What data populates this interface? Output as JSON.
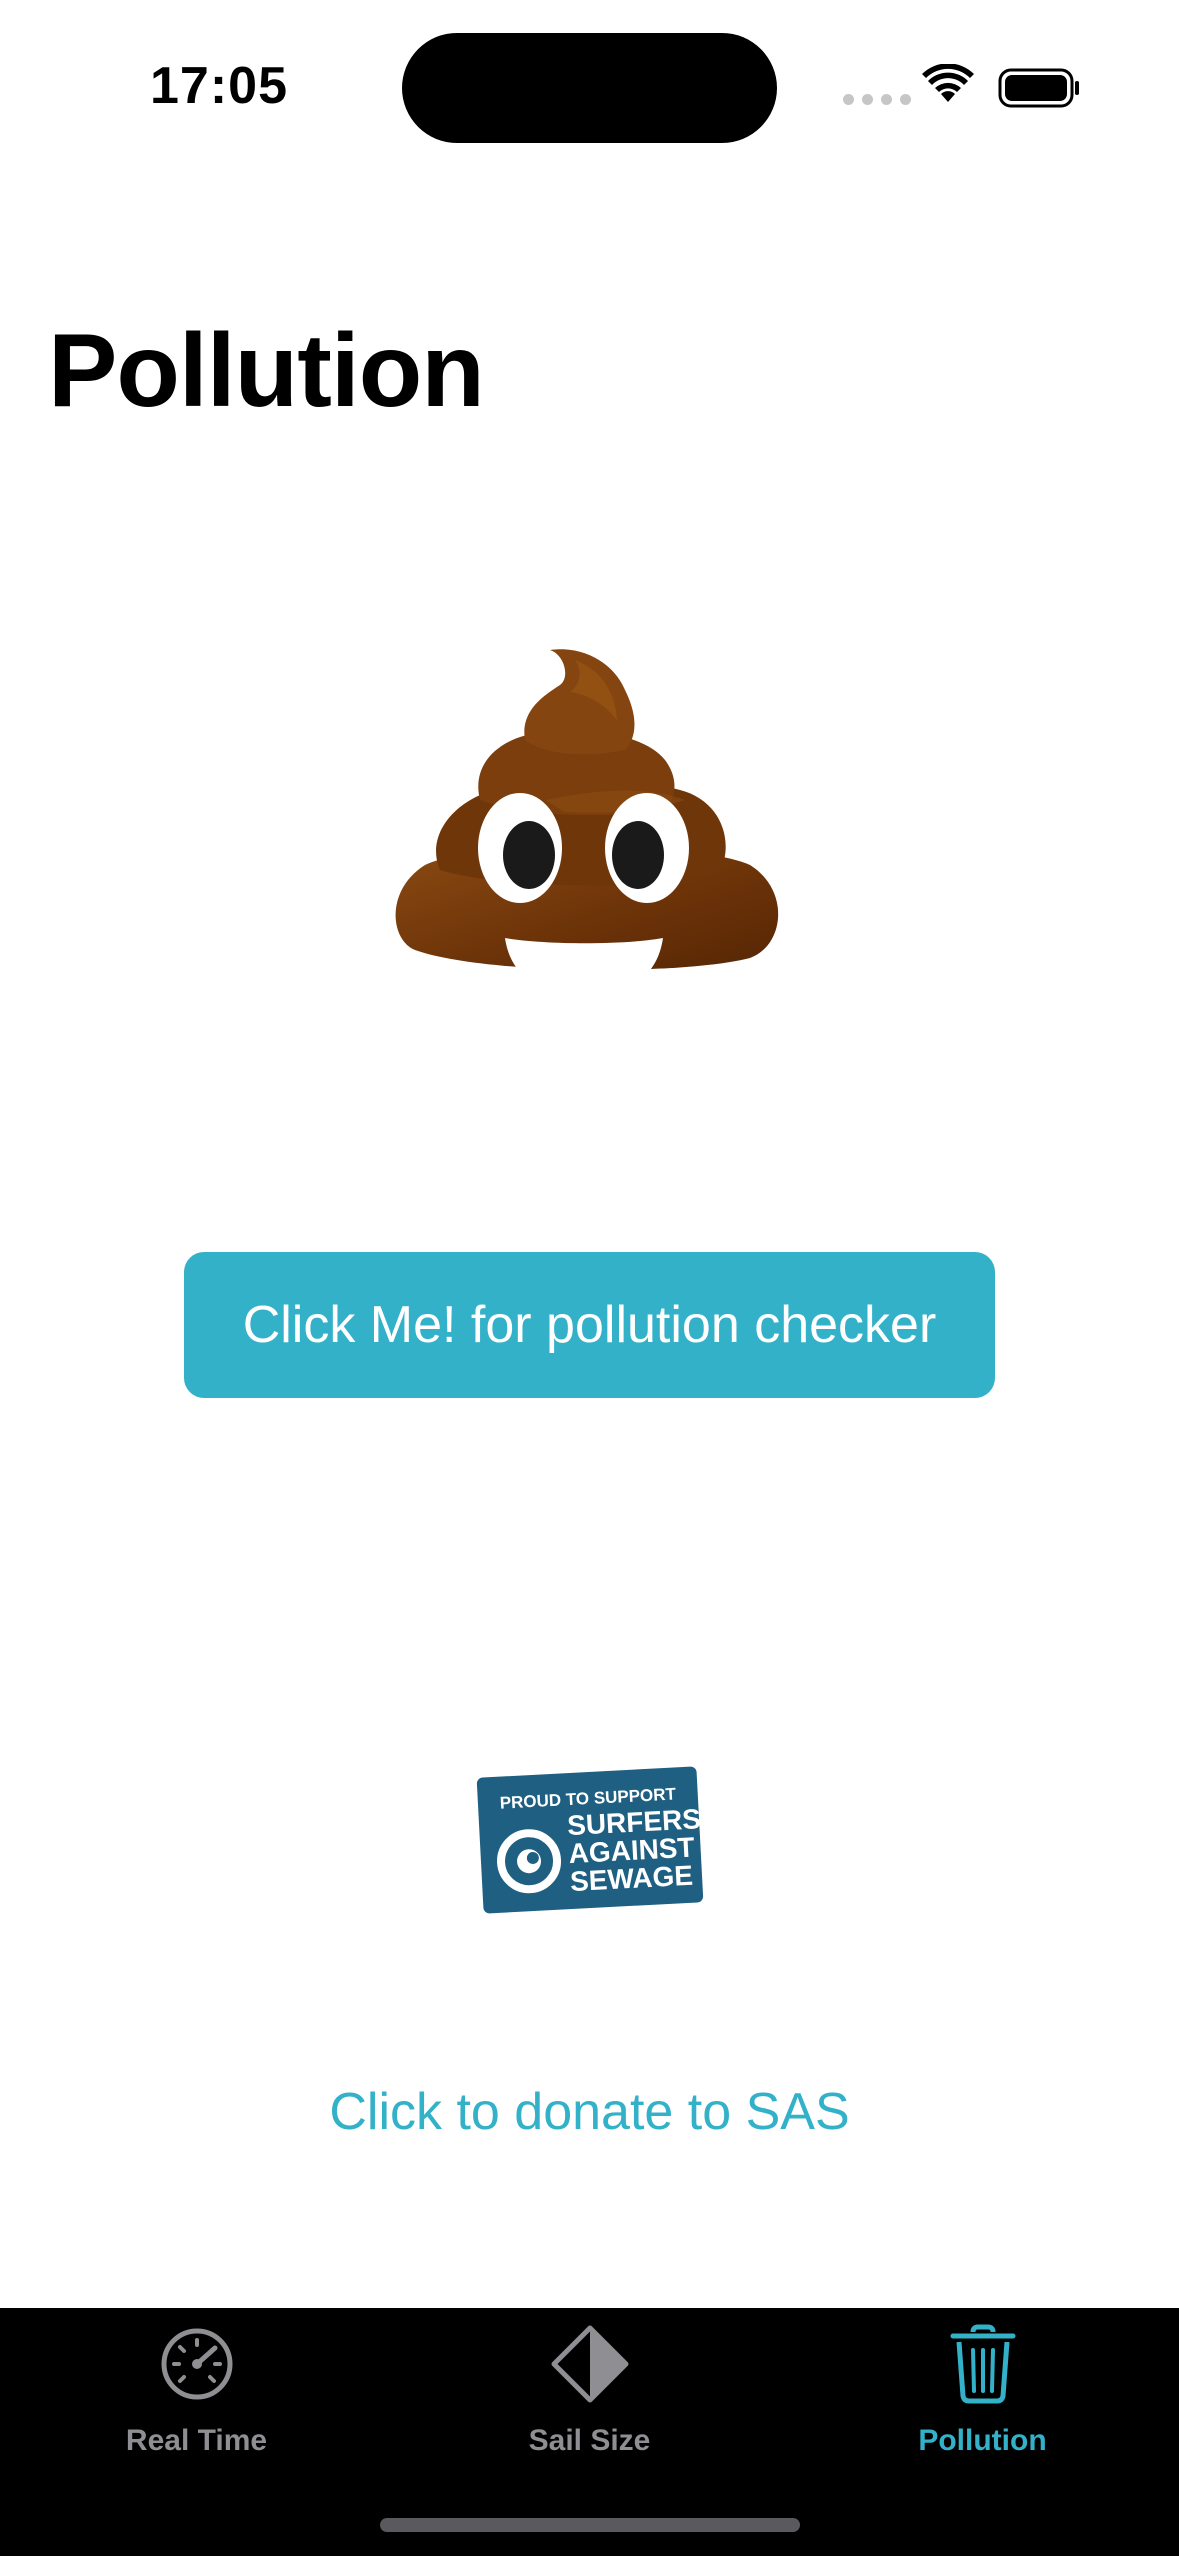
{
  "status_bar": {
    "time": "17:05"
  },
  "page": {
    "title": "Pollution",
    "pollution_button_label": "Click Me! for pollution checker",
    "donate_link_label": "Click to donate to SAS"
  },
  "sas_logo": {
    "line1": "PROUD TO SUPPORT",
    "line2": "SURFERS",
    "line3": "AGAINST",
    "line4": "SEWAGE"
  },
  "tab_bar": {
    "tabs": [
      {
        "label": "Real Time",
        "icon": "speedometer-icon",
        "active": false
      },
      {
        "label": "Sail Size",
        "icon": "sail-diamond-icon",
        "active": false
      },
      {
        "label": "Pollution",
        "icon": "trash-icon",
        "active": true
      }
    ]
  },
  "colors": {
    "accent": "#33b1c9",
    "tab_inactive": "#8e8e93",
    "tab_bar_bg": "#000000",
    "sas_blue": "#1e5f82"
  }
}
